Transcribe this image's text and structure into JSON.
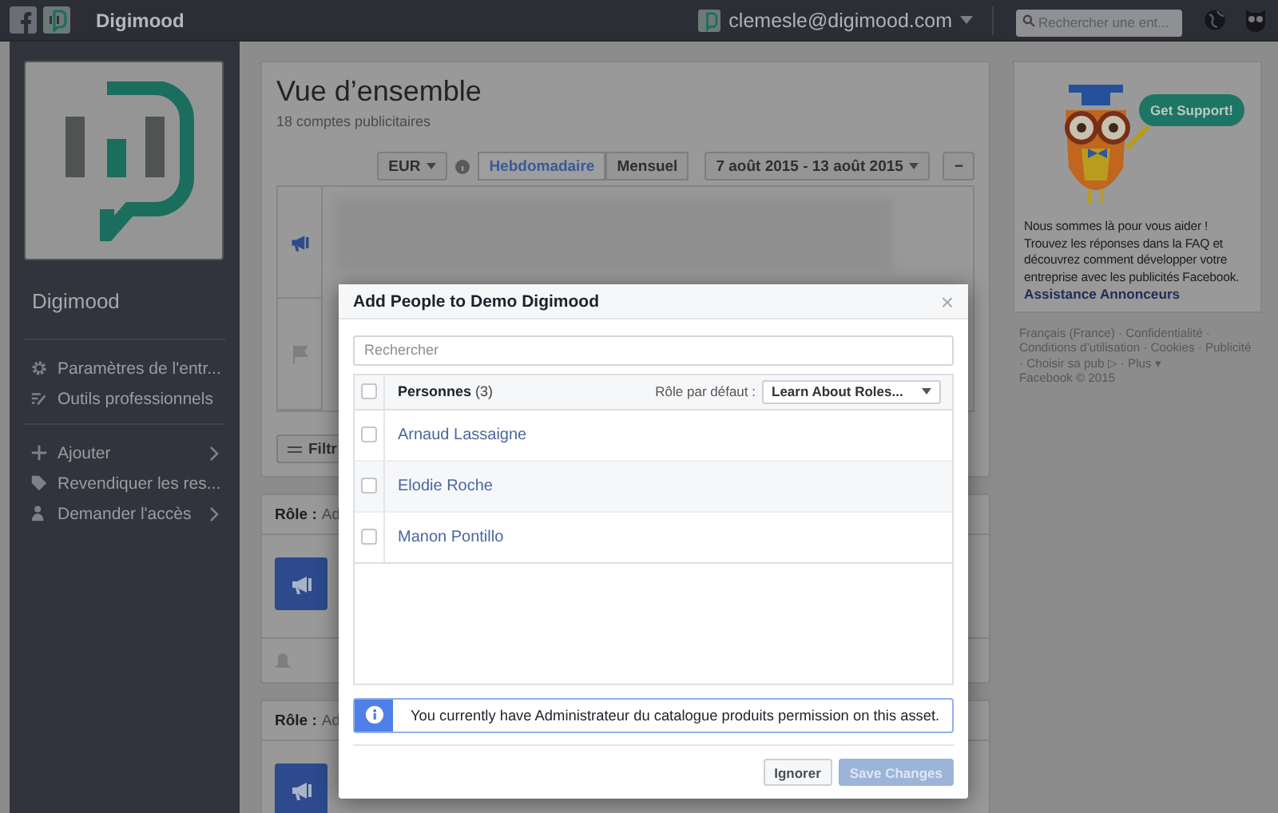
{
  "top_bar": {
    "brand": "Digimood",
    "account": "clemesle@digimood.com",
    "search": {
      "placeholder": "Rechercher une ent..."
    }
  },
  "sidebar": {
    "page_name": "Digimood",
    "groups": [
      [
        {
          "label": "Paramètres de l'entr..."
        },
        {
          "label": "Outils professionnels"
        }
      ],
      [
        {
          "label": "Ajouter"
        },
        {
          "label": "Revendiquer les res..."
        },
        {
          "label": "Demander l'accès"
        }
      ]
    ]
  },
  "overview": {
    "title": "Vue d’ensemble",
    "subtitle": "18 comptes publicitaires",
    "currency": "EUR",
    "periods": [
      {
        "label": "Hebdomadaire",
        "selected": true
      },
      {
        "label": "Mensuel",
        "selected": false
      }
    ],
    "date_range": "7 août 2015 - 13 août 2015",
    "collapse": "−",
    "filter_button": "Filtr"
  },
  "role_cards": [
    {
      "label": "Rôle :",
      "value": "Ad"
    },
    {
      "label": "Rôle :",
      "value": "Ad"
    }
  ],
  "support": {
    "bubble": "Get Support!",
    "text": "Nous sommes là pour vous aider ! Trouvez les réponses dans la FAQ et découvrez comment développer votre entreprise avec les publicités Facebook.",
    "link": "Assistance Annonceurs"
  },
  "footer": {
    "links": "Français (France) · Confidentialité · Conditions d’utilisation · Cookies · Publicité · Choisir sa pub ▷ · Plus ▾",
    "copyright": "Facebook © 2015"
  },
  "dialog": {
    "title": "Add People to Demo Digimood",
    "close": "×",
    "search": {
      "placeholder": "Rechercher"
    },
    "header": {
      "label": "**Personnes** (3)",
      "checked": false,
      "default_role_label": "Rôle par défaut :",
      "role_select": "Learn About Roles..."
    },
    "people": [
      {
        "name": "Arnaud Lassaigne",
        "checked": false
      },
      {
        "name": "Elodie Roche",
        "checked": false
      },
      {
        "name": "Manon Pontillo",
        "checked": false
      }
    ],
    "notice": "You currently have Administrateur du catalogue produits permission on this asset.",
    "buttons": [
      {
        "label": "Ignorer",
        "kind": "secondary",
        "disabled": false
      },
      {
        "label": "Save Changes",
        "kind": "primary",
        "disabled": true
      }
    ]
  }
}
